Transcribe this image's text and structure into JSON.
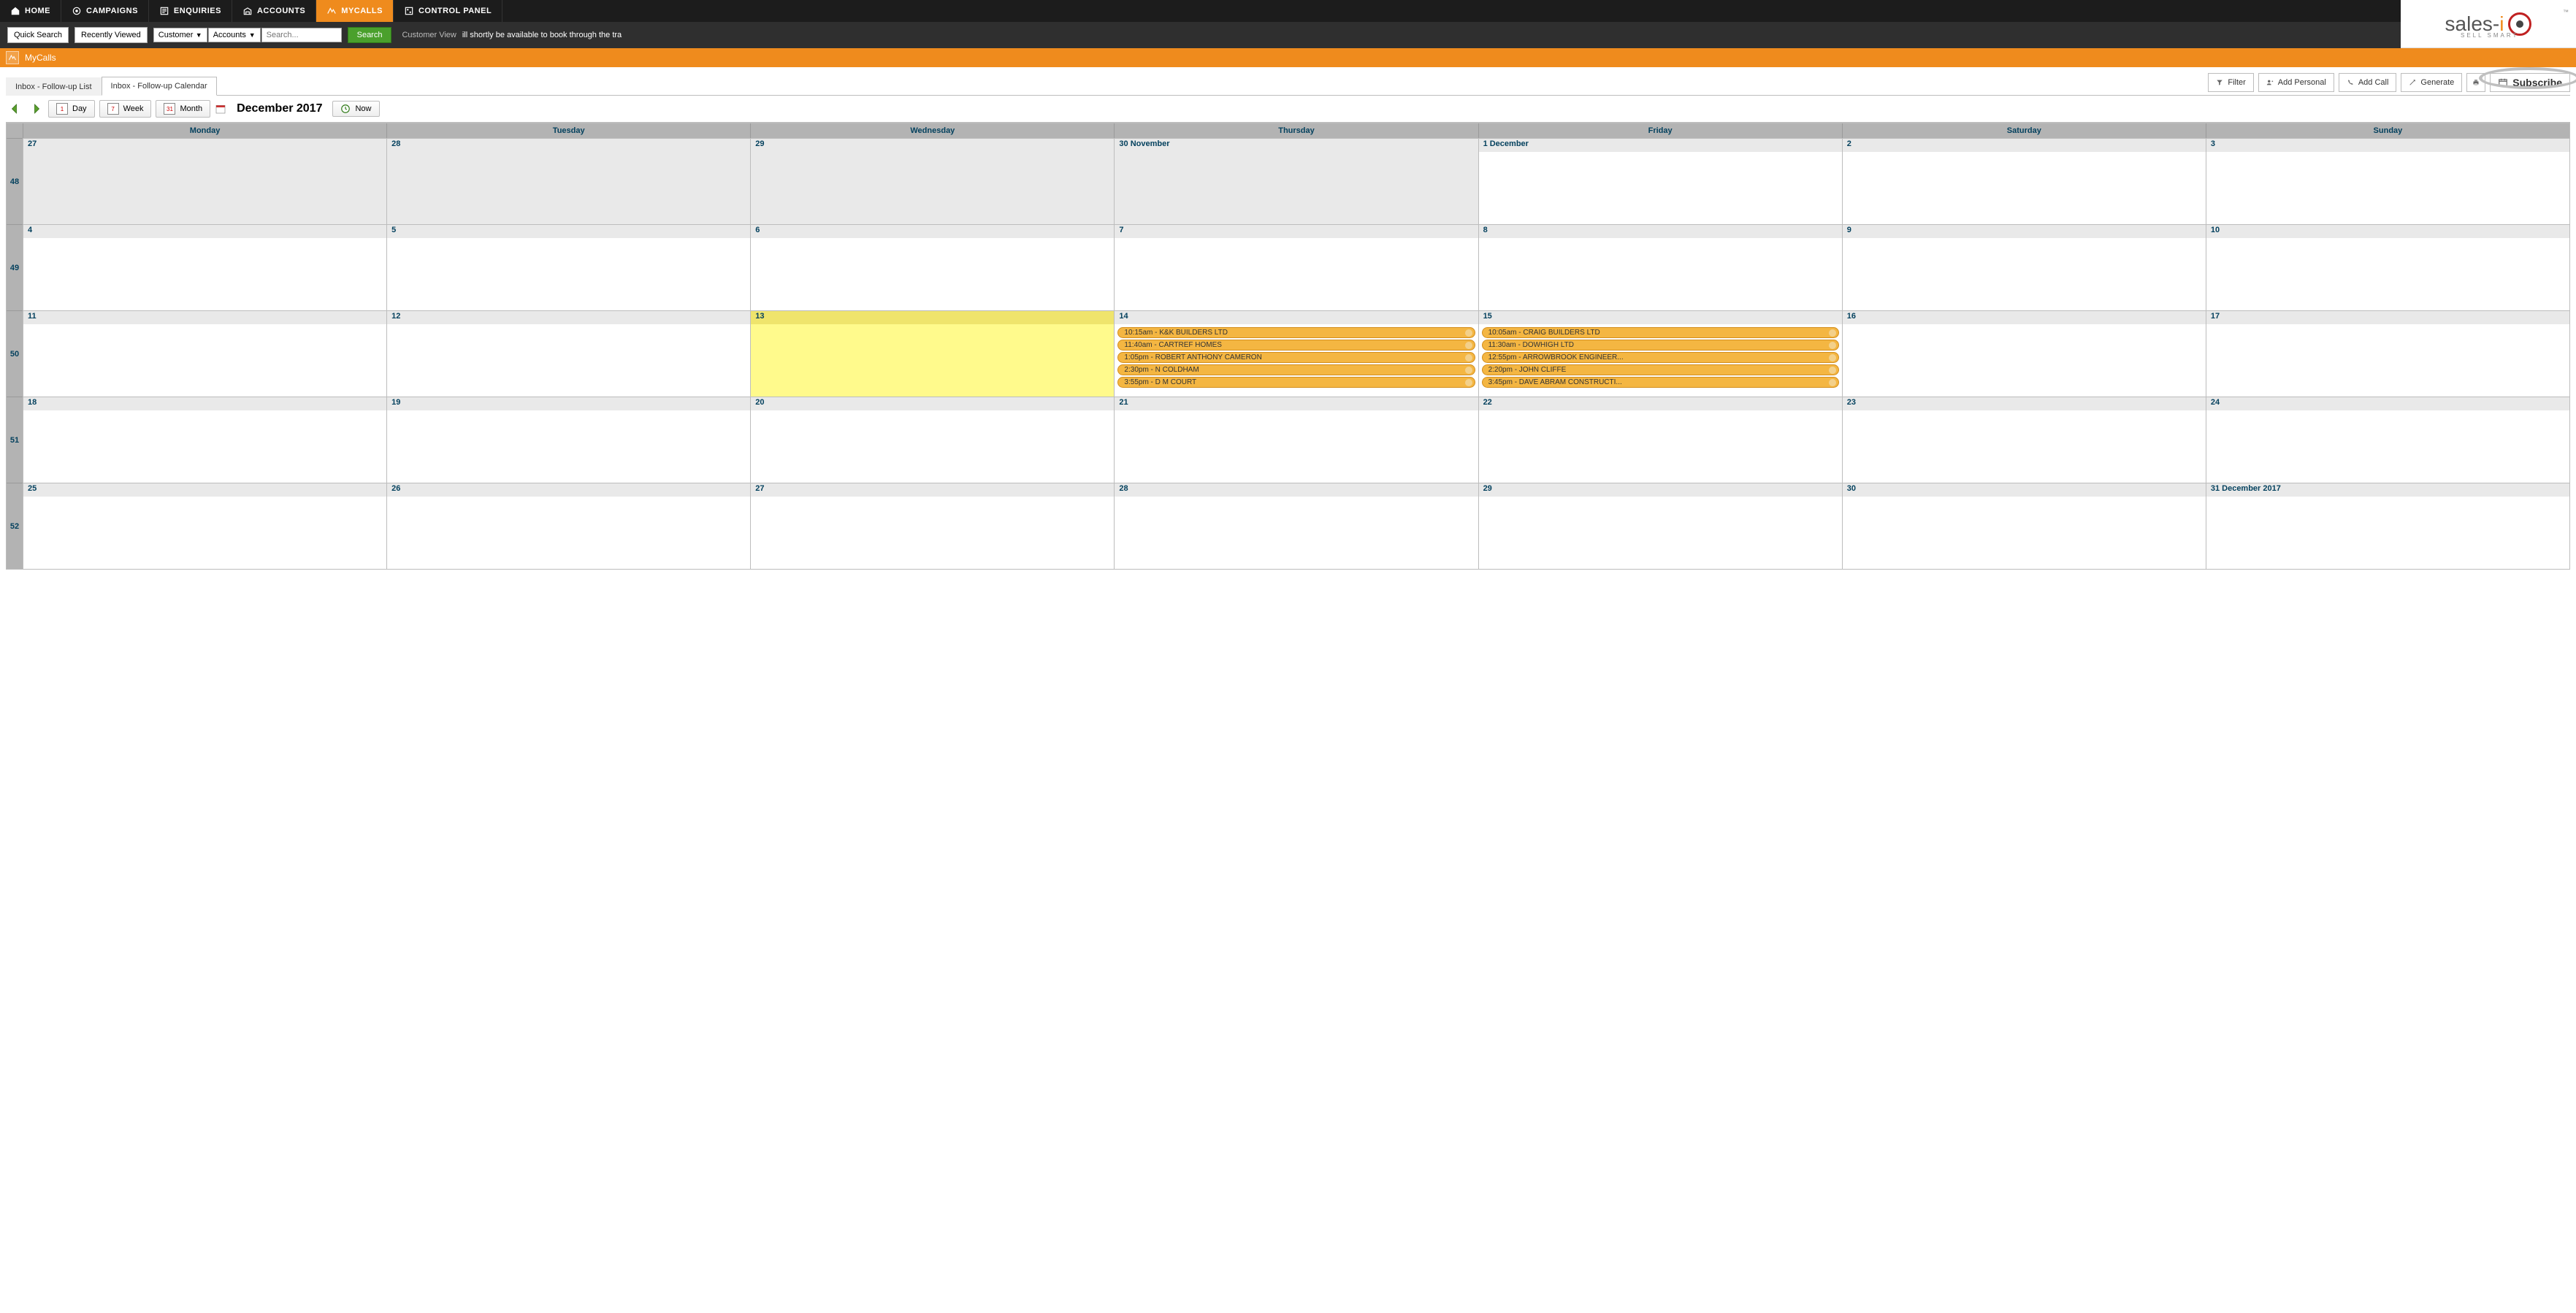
{
  "nav": {
    "items": [
      {
        "label": "HOME",
        "icon": "home"
      },
      {
        "label": "CAMPAIGNS",
        "icon": "campaign"
      },
      {
        "label": "ENQUIRIES",
        "icon": "enquiries"
      },
      {
        "label": "ACCOUNTS",
        "icon": "accounts"
      },
      {
        "label": "MYCALLS",
        "icon": "mycalls",
        "active": true
      },
      {
        "label": "CONTROL PANEL",
        "icon": "control"
      }
    ]
  },
  "brand": {
    "name": "sales-i",
    "tagline": "SELL SMART",
    "tm": "™"
  },
  "searchbar": {
    "quick_search": "Quick Search",
    "recently_viewed": "Recently Viewed",
    "customer_select": "Customer",
    "accounts_select": "Accounts",
    "search_placeholder": "Search...",
    "search_btn": "Search",
    "customer_view": "Customer View",
    "ticker": "ill shortly be available to book through the tra"
  },
  "page_header": {
    "title": "MyCalls"
  },
  "tabs": {
    "list": "Inbox - Follow-up List",
    "calendar": "Inbox - Follow-up Calendar"
  },
  "actions": {
    "filter": "Filter",
    "add_personal": "Add Personal",
    "add_call": "Add Call",
    "generate": "Generate",
    "subscribe": "Subscribe"
  },
  "cal_toolbar": {
    "day": "Day",
    "week": "Week",
    "month": "Month",
    "now": "Now",
    "title": "December 2017",
    "mini_day": "1",
    "mini_week": "7",
    "mini_month": "31"
  },
  "calendar": {
    "day_names": [
      "Monday",
      "Tuesday",
      "Wednesday",
      "Thursday",
      "Friday",
      "Saturday",
      "Sunday"
    ],
    "week_numbers": [
      "48",
      "49",
      "50",
      "51",
      "52"
    ],
    "rows": [
      [
        {
          "label": "27",
          "dim": true
        },
        {
          "label": "28",
          "dim": true
        },
        {
          "label": "29",
          "dim": true
        },
        {
          "label": "30 November",
          "dim": true
        },
        {
          "label": "1 December"
        },
        {
          "label": "2"
        },
        {
          "label": "3"
        }
      ],
      [
        {
          "label": "4"
        },
        {
          "label": "5"
        },
        {
          "label": "6"
        },
        {
          "label": "7"
        },
        {
          "label": "8"
        },
        {
          "label": "9"
        },
        {
          "label": "10"
        }
      ],
      [
        {
          "label": "11"
        },
        {
          "label": "12"
        },
        {
          "label": "13",
          "today": true
        },
        {
          "label": "14",
          "events": [
            "10:15am - K&K BUILDERS LTD",
            "11:40am - CARTREF HOMES",
            "1:05pm - ROBERT ANTHONY CAMERON",
            "2:30pm - N COLDHAM",
            "3:55pm - D M COURT"
          ]
        },
        {
          "label": "15",
          "events": [
            "10:05am - CRAIG BUILDERS LTD",
            "11:30am - DOWHIGH LTD",
            "12:55pm - ARROWBROOK ENGINEER...",
            "2:20pm - JOHN CLIFFE",
            "3:45pm - DAVE ABRAM CONSTRUCTI..."
          ]
        },
        {
          "label": "16"
        },
        {
          "label": "17"
        }
      ],
      [
        {
          "label": "18"
        },
        {
          "label": "19"
        },
        {
          "label": "20"
        },
        {
          "label": "21"
        },
        {
          "label": "22"
        },
        {
          "label": "23"
        },
        {
          "label": "24"
        }
      ],
      [
        {
          "label": "25"
        },
        {
          "label": "26"
        },
        {
          "label": "27"
        },
        {
          "label": "28"
        },
        {
          "label": "29"
        },
        {
          "label": "30"
        },
        {
          "label": "31 December 2017"
        }
      ]
    ]
  }
}
